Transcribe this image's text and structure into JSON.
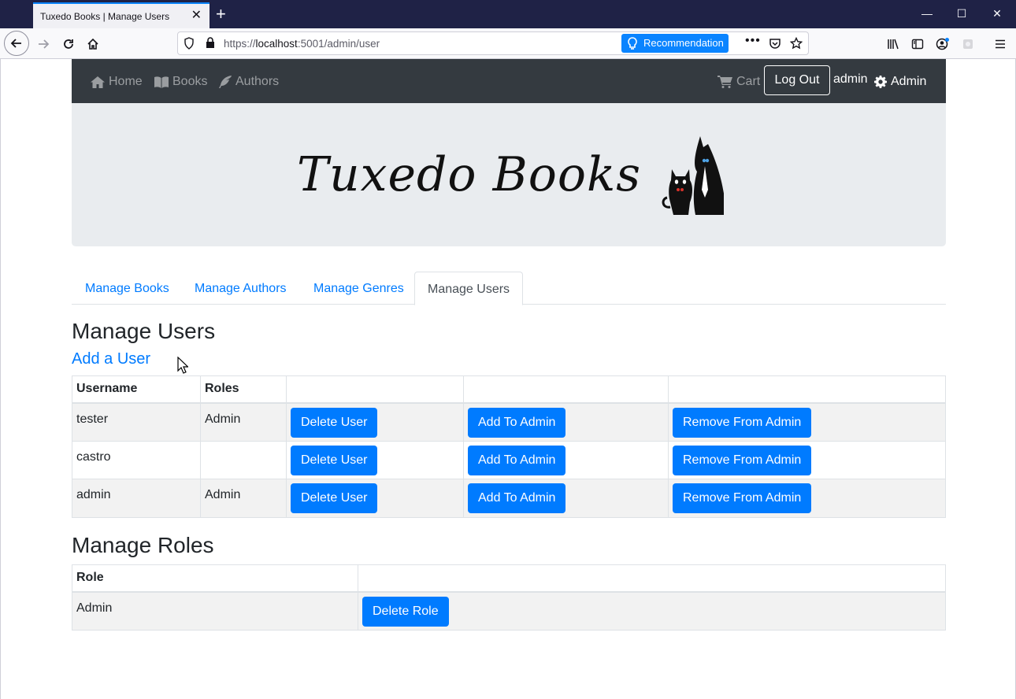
{
  "browser": {
    "tab_title": "Tuxedo Books | Manage Users",
    "url_prefix": "https://",
    "url_host": "localhost",
    "url_path": ":5001/admin/user",
    "recommendation_label": "Recommendation"
  },
  "sitenav": {
    "home": "Home",
    "books": "Books",
    "authors": "Authors",
    "cart": "Cart",
    "logout": "Log Out",
    "username": "admin",
    "admin": "Admin"
  },
  "banner": {
    "brand": "Tuxedo Books"
  },
  "tabs": [
    {
      "label": "Manage Books"
    },
    {
      "label": "Manage Authors"
    },
    {
      "label": "Manage Genres"
    },
    {
      "label": "Manage Users"
    }
  ],
  "users": {
    "heading": "Manage Users",
    "add_link": "Add a User",
    "columns": [
      "Username",
      "Roles"
    ],
    "rows": [
      {
        "username": "tester",
        "roles": "Admin"
      },
      {
        "username": "castro",
        "roles": ""
      },
      {
        "username": "admin",
        "roles": "Admin"
      }
    ],
    "delete_label": "Delete User",
    "add_admin_label": "Add To Admin",
    "remove_admin_label": "Remove From Admin"
  },
  "roles": {
    "heading": "Manage Roles",
    "column": "Role",
    "rows": [
      {
        "role": "Admin"
      }
    ],
    "delete_label": "Delete Role"
  }
}
